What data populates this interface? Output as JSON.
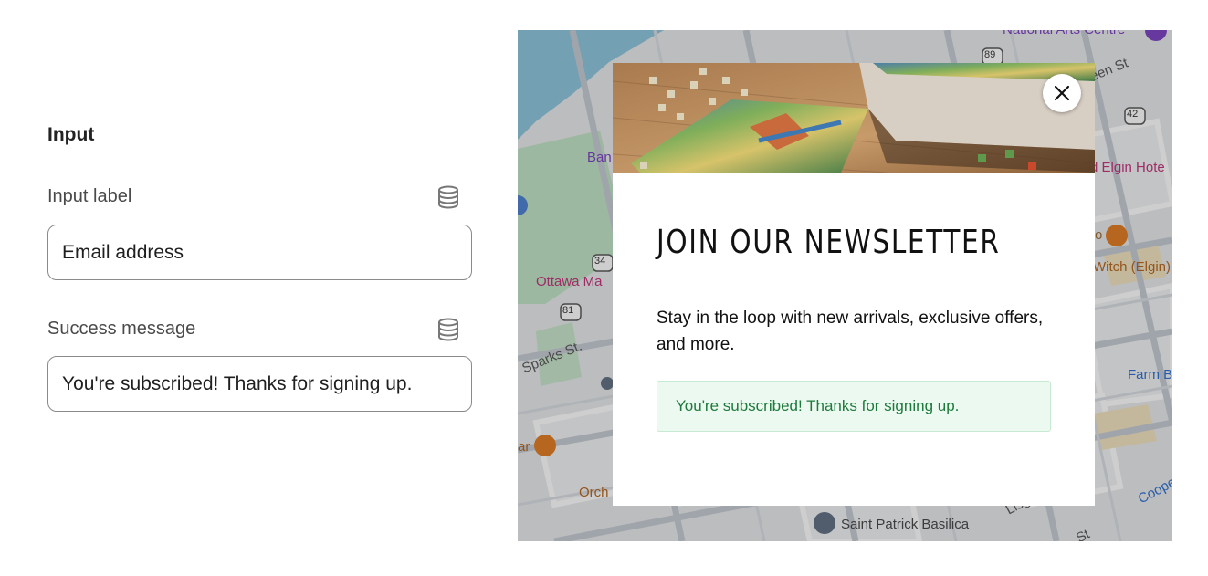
{
  "settings": {
    "section_title": "Input",
    "input_label": {
      "label": "Input label",
      "value": "Email address",
      "icon": "database-icon"
    },
    "success_message": {
      "label": "Success message",
      "value": "You're subscribed! Thanks for signing up.",
      "icon": "database-icon"
    }
  },
  "map": {
    "labels": {
      "national_arts_centre": "National Arts Centre",
      "queen_st": "een St",
      "elgin_hotel": "d Elgin Hote",
      "witch": "Witch (Elgin)",
      "ottawa_ma": "Ottawa Ma",
      "ban": "Ban",
      "sparks_st": "Sparks St.",
      "farm": "Farm B",
      "orch": "Orch",
      "ar": "ar",
      "saint_patrick": "Saint Patrick Basilica",
      "lisg": "Lisg",
      "coop": "Coope",
      "st": "St",
      "o_label": "o",
      "route_89": "89",
      "route_42": "42",
      "route_34": "34",
      "route_81": "81"
    }
  },
  "modal": {
    "title": "JOIN OUR NEWSLETTER",
    "description": "Stay in the loop with new arrivals, exclusive offers, and more.",
    "success_text": "You're subscribed! Thanks for signing up.",
    "close_icon": "close-icon",
    "hero_image": "jigsaw-puzzle-image"
  },
  "colors": {
    "success_bg": "#ecf9f0",
    "success_text": "#1e7a3c",
    "input_border": "#8a8a8a"
  }
}
